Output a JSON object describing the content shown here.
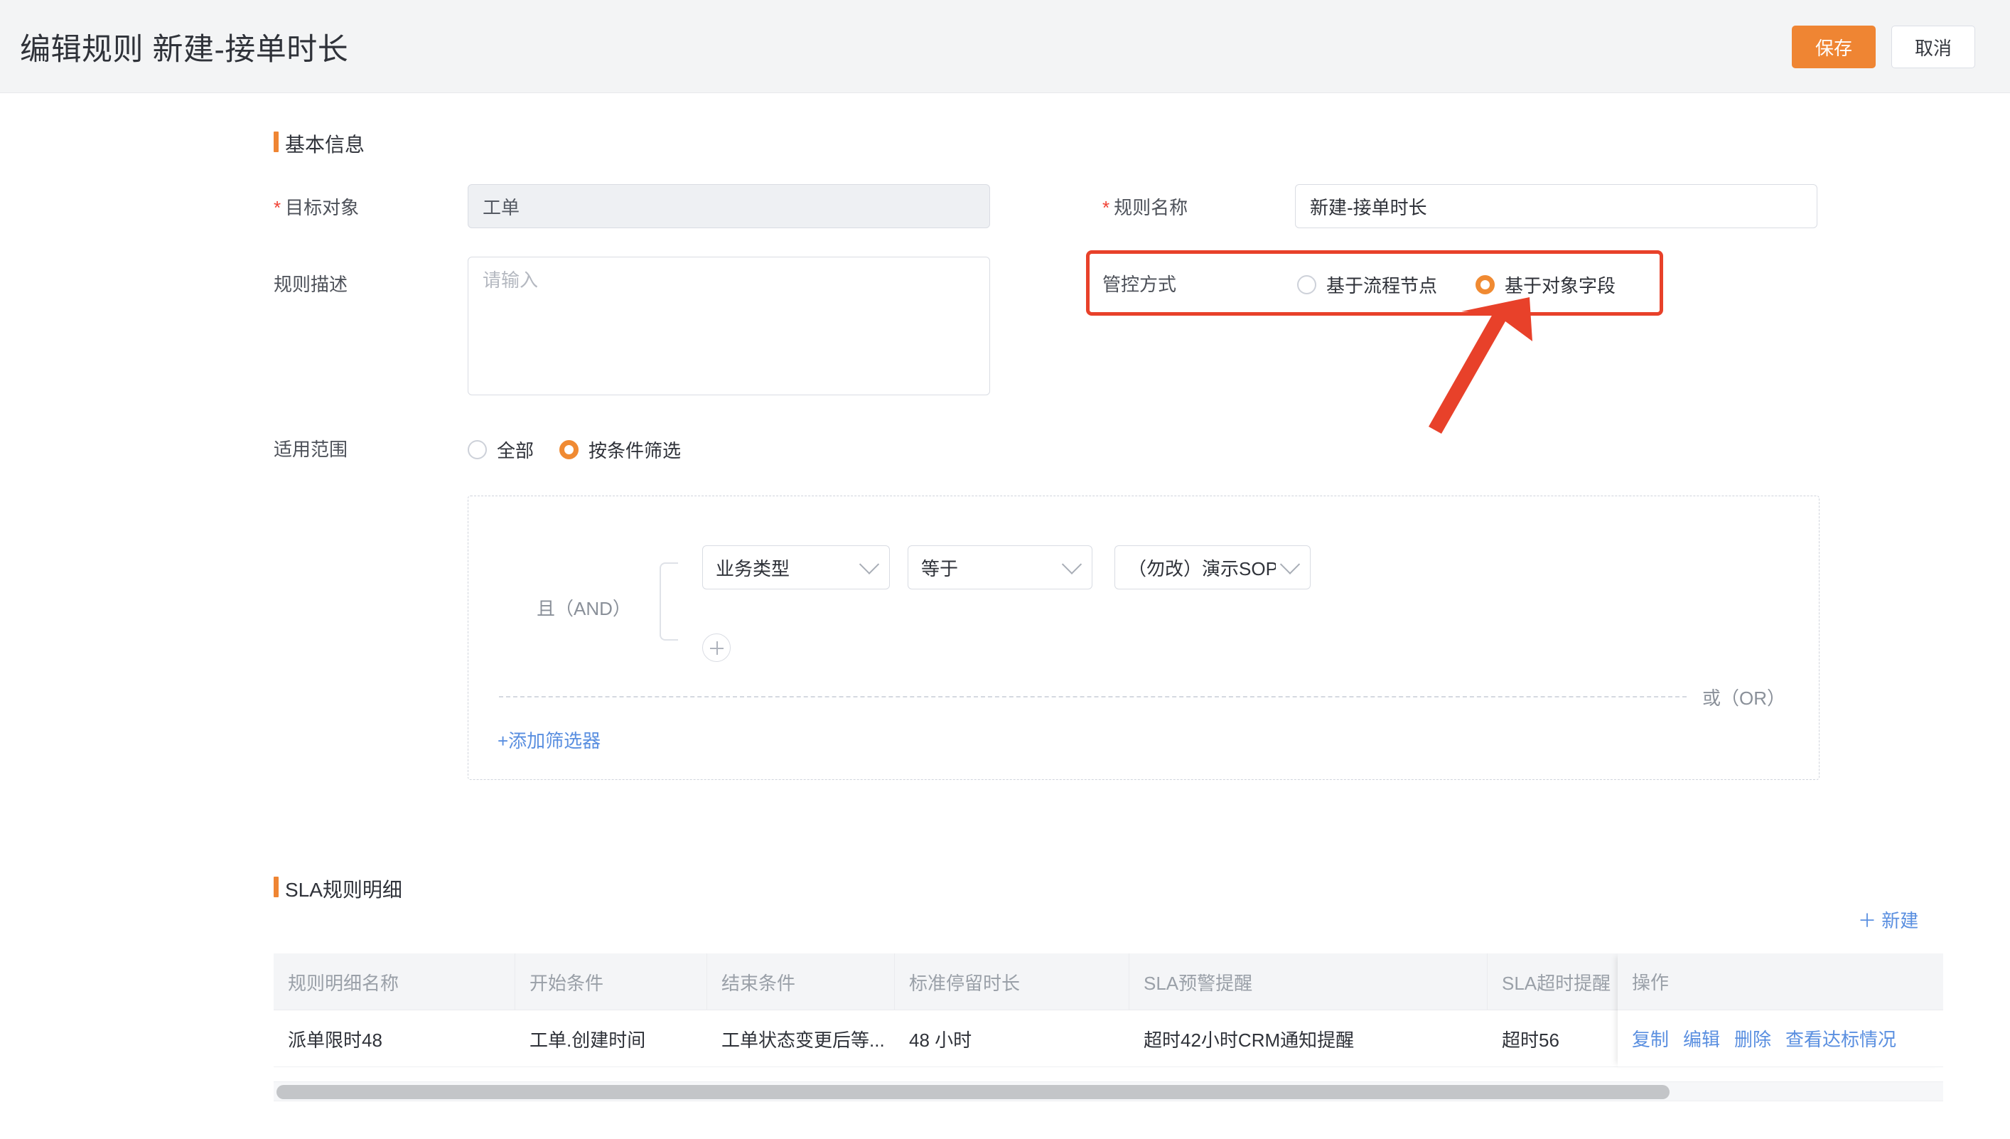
{
  "header": {
    "title": "编辑规则 新建-接单时长",
    "save_label": "保存",
    "cancel_label": "取消"
  },
  "basic_info": {
    "section_title": "基本信息",
    "target_object": {
      "label": "目标对象",
      "required_mark": "*",
      "value": "工单"
    },
    "rule_name": {
      "label": "规则名称",
      "required_mark": "*",
      "value": "新建-接单时长"
    },
    "rule_desc": {
      "label": "规则描述",
      "value": "",
      "placeholder": "请输入"
    },
    "control_mode": {
      "label": "管控方式",
      "options": [
        {
          "label": "基于流程节点",
          "selected": false
        },
        {
          "label": "基于对象字段",
          "selected": true
        }
      ]
    },
    "apply_scope": {
      "label": "适用范围",
      "options": [
        {
          "label": "全部",
          "selected": false
        },
        {
          "label": "按条件筛选",
          "selected": true
        }
      ]
    }
  },
  "filter_panel": {
    "and_label": "且（AND）",
    "or_label": "或（OR）",
    "add_filter_label": "+添加筛选器",
    "add_condition_icon": "plus-icon",
    "condition": {
      "field": "业务类型",
      "operator": "等于",
      "value": "（勿改）演示SOP"
    }
  },
  "sla_section": {
    "section_title": "SLA规则明细",
    "new_label": "＋ 新建",
    "columns": [
      "规则明细名称",
      "开始条件",
      "结束条件",
      "标准停留时长",
      "SLA预警提醒",
      "SLA超时提醒"
    ],
    "action_column": "操作",
    "rows": [
      {
        "name": "派单限时48",
        "start_condition": "工单.创建时间",
        "end_condition": "工单状态变更后等...",
        "standard_duration": "48 小时",
        "warn_notice": "超时42小时CRM通知提醒",
        "timeout_notice": "超时56"
      }
    ],
    "actions": [
      "复制",
      "编辑",
      "删除",
      "查看达标情况"
    ]
  },
  "annotation": {
    "highlight_color": "#e8412a",
    "arrow_color": "#e8412a",
    "arrow_icon": "arrow-up-right-icon"
  }
}
